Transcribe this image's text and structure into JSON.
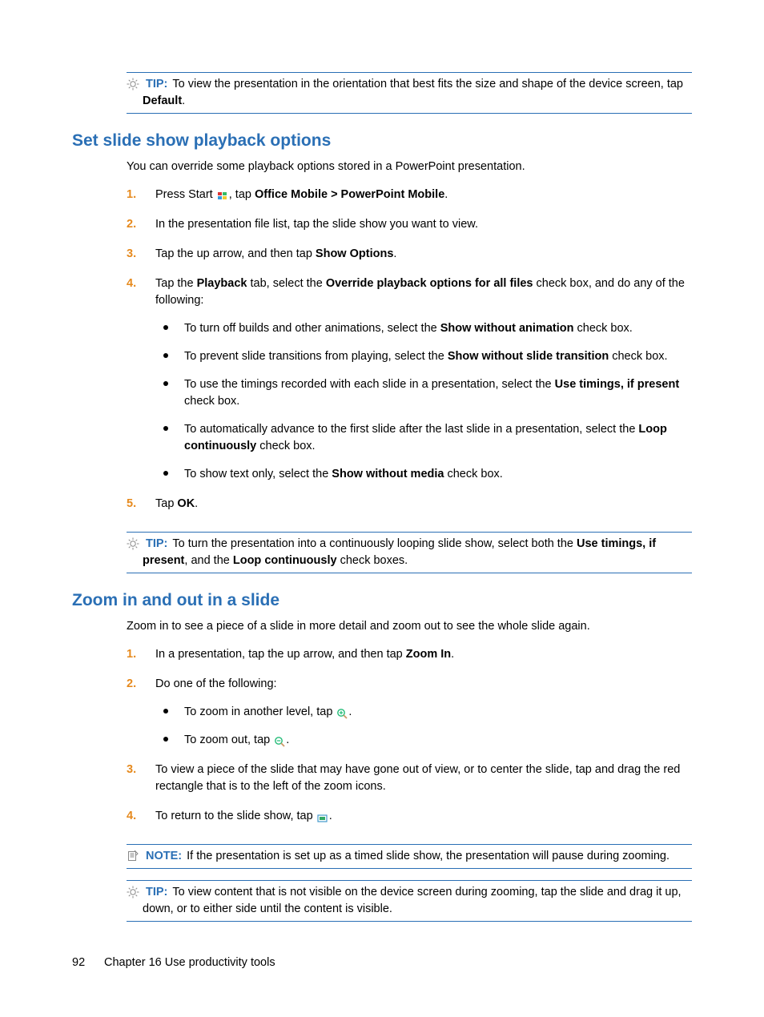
{
  "callouts": {
    "tip1": {
      "label": "TIP:",
      "body_pre": "To view the presentation in the orientation that best fits the size and shape of the device screen, tap ",
      "body_bold": "Default",
      "body_post": "."
    },
    "tip2": {
      "label": "TIP:",
      "body_pre": "To turn the presentation into a continuously looping slide show, select both the ",
      "bold1": "Use timings, if present",
      "mid": ", and the ",
      "bold2": "Loop continuously",
      "post": " check boxes."
    },
    "note1": {
      "label": "NOTE:",
      "body": "If the presentation is set up as a timed slide show, the presentation will pause during zooming."
    },
    "tip3": {
      "label": "TIP:",
      "body": "To view content that is not visible on the device screen during zooming, tap the slide and drag it up, down, or to either side until the content is visible."
    }
  },
  "section1": {
    "heading": "Set slide show playback options",
    "intro": "You can override some playback options stored in a PowerPoint presentation.",
    "steps": {
      "s1_pre": "Press Start ",
      "s1_mid": ", tap ",
      "s1_bold": "Office Mobile > PowerPoint Mobile",
      "s1_post": ".",
      "s2": "In the presentation file list, tap the slide show you want to view.",
      "s3_pre": "Tap the up arrow, and then tap ",
      "s3_bold": "Show Options",
      "s3_post": ".",
      "s4_pre": "Tap the ",
      "s4_bold1": "Playback",
      "s4_mid": " tab, select the ",
      "s4_bold2": "Override playback options for all files",
      "s4_post": " check box, and do any of the following:",
      "s4_bullets": {
        "b1_pre": "To turn off builds and other animations, select the ",
        "b1_bold": "Show without animation",
        "b1_post": " check box.",
        "b2_pre": "To prevent slide transitions from playing, select the ",
        "b2_bold": "Show without slide transition",
        "b2_post": " check box.",
        "b3_pre": "To use the timings recorded with each slide in a presentation, select the ",
        "b3_bold": "Use timings, if present",
        "b3_post": " check box.",
        "b4_pre": "To automatically advance to the first slide after the last slide in a presentation, select the ",
        "b4_bold": "Loop continuously",
        "b4_post": " check box.",
        "b5_pre": "To show text only, select the ",
        "b5_bold": "Show without media",
        "b5_post": " check box."
      },
      "s5_pre": "Tap ",
      "s5_bold": "OK",
      "s5_post": "."
    }
  },
  "section2": {
    "heading": "Zoom in and out in a slide",
    "intro": "Zoom in to see a piece of a slide in more detail and zoom out to see the whole slide again.",
    "steps": {
      "s1_pre": "In a presentation, tap the up arrow, and then tap ",
      "s1_bold": "Zoom In",
      "s1_post": ".",
      "s2": "Do one of the following:",
      "s2_bullets": {
        "b1": "To zoom in another level, tap ",
        "b1_post": ".",
        "b2": "To zoom out, tap ",
        "b2_post": "."
      },
      "s3": "To view a piece of the slide that may have gone out of view, or to center the slide, tap and drag the red rectangle that is to the left of the zoom icons.",
      "s4_pre": "To return to the slide show, tap ",
      "s4_post": "."
    }
  },
  "footer": {
    "pagenum": "92",
    "chapter": "Chapter 16   Use productivity tools"
  }
}
